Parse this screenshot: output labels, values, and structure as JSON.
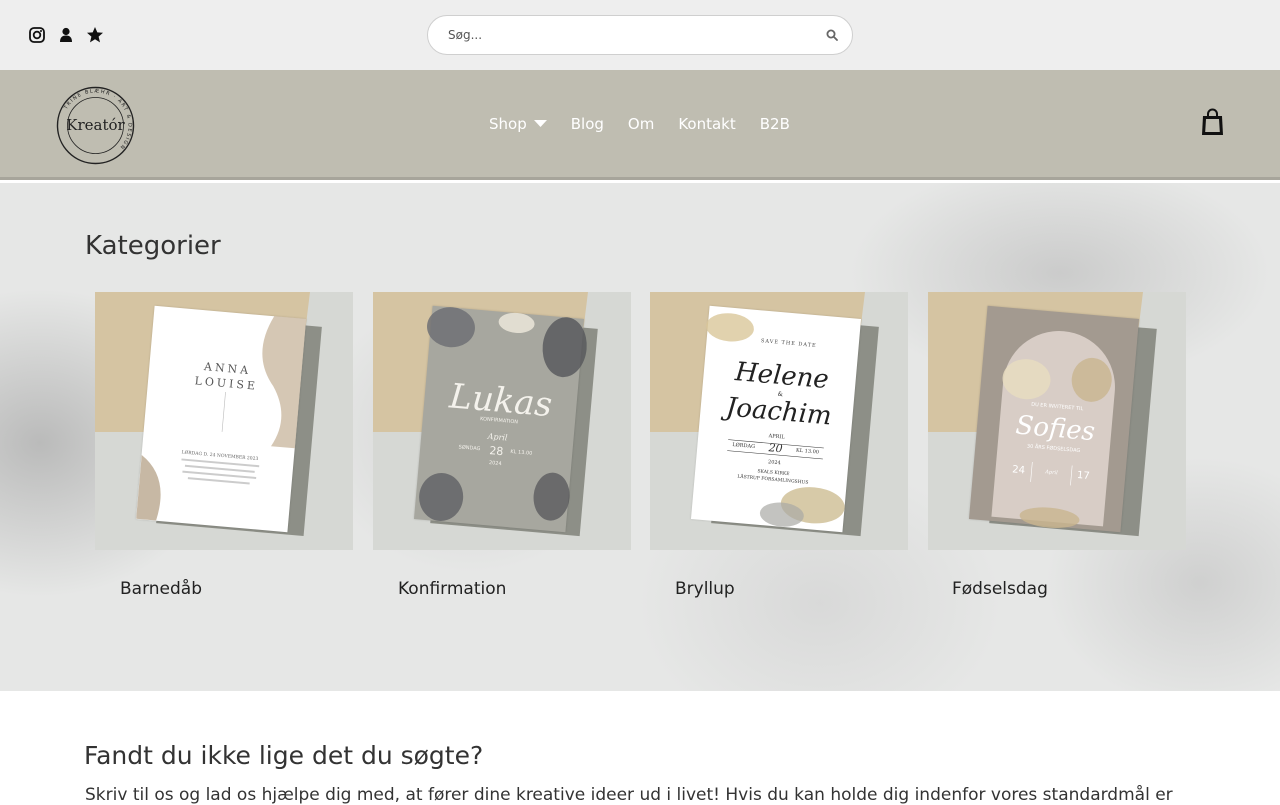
{
  "topbar": {
    "social_icons": [
      "instagram-icon",
      "user-icon",
      "star-icon"
    ],
    "search": {
      "placeholder": "Søg...",
      "value": ""
    }
  },
  "header": {
    "logo": {
      "text": "Kreatór",
      "ring_text": "TRINE BLÆHR · ART & DESIGN"
    },
    "nav": [
      {
        "label": "Shop",
        "has_dropdown": true
      },
      {
        "label": "Blog"
      },
      {
        "label": "Om"
      },
      {
        "label": "Kontakt"
      },
      {
        "label": "B2B"
      }
    ],
    "cart_icon": "shopping-bag-icon",
    "colors": {
      "background": "#bfbdb1",
      "nav_text": "#ffffff"
    }
  },
  "categories": {
    "title": "Kategorier",
    "items": [
      {
        "label": "Barnedåb",
        "invitation": {
          "line1": "ANNA",
          "line2": "LOUISE",
          "detail": "LØRDAG D. 24 NOVEMBER 2023"
        }
      },
      {
        "label": "Konfirmation",
        "invitation": {
          "name": "Lukas",
          "sub": "KONFIRMATION",
          "day": "SØNDAG",
          "month": "April",
          "date": "28",
          "time": "KL 13.00",
          "year": "2024"
        }
      },
      {
        "label": "Bryllup",
        "invitation": {
          "top": "SAVE THE DATE",
          "name1": "Helene",
          "amp": "&",
          "name2": "Joachim",
          "month": "APRIL",
          "day": "LØRDAG",
          "date": "20",
          "time": "KL 13.00",
          "year": "2024",
          "place": "SKALS KIRKE",
          "place2": "LÅSTRUP FORSAMLINGSHUS"
        }
      },
      {
        "label": "Fødselsdag",
        "invitation": {
          "top": "DU ER INVITERET TIL",
          "name": "Sofies",
          "sub": "30 ÅRS FØDSELSDAG",
          "date": "24",
          "month": "April",
          "time": "17"
        }
      }
    ]
  },
  "more": {
    "title": "Fandt du ikke lige det du søgte?",
    "text": "Skriv til os og lad os hjælpe dig med, at fører dine kreative ideer ud i livet! Hvis du kan holde dig indenfor vores standardmål er"
  }
}
